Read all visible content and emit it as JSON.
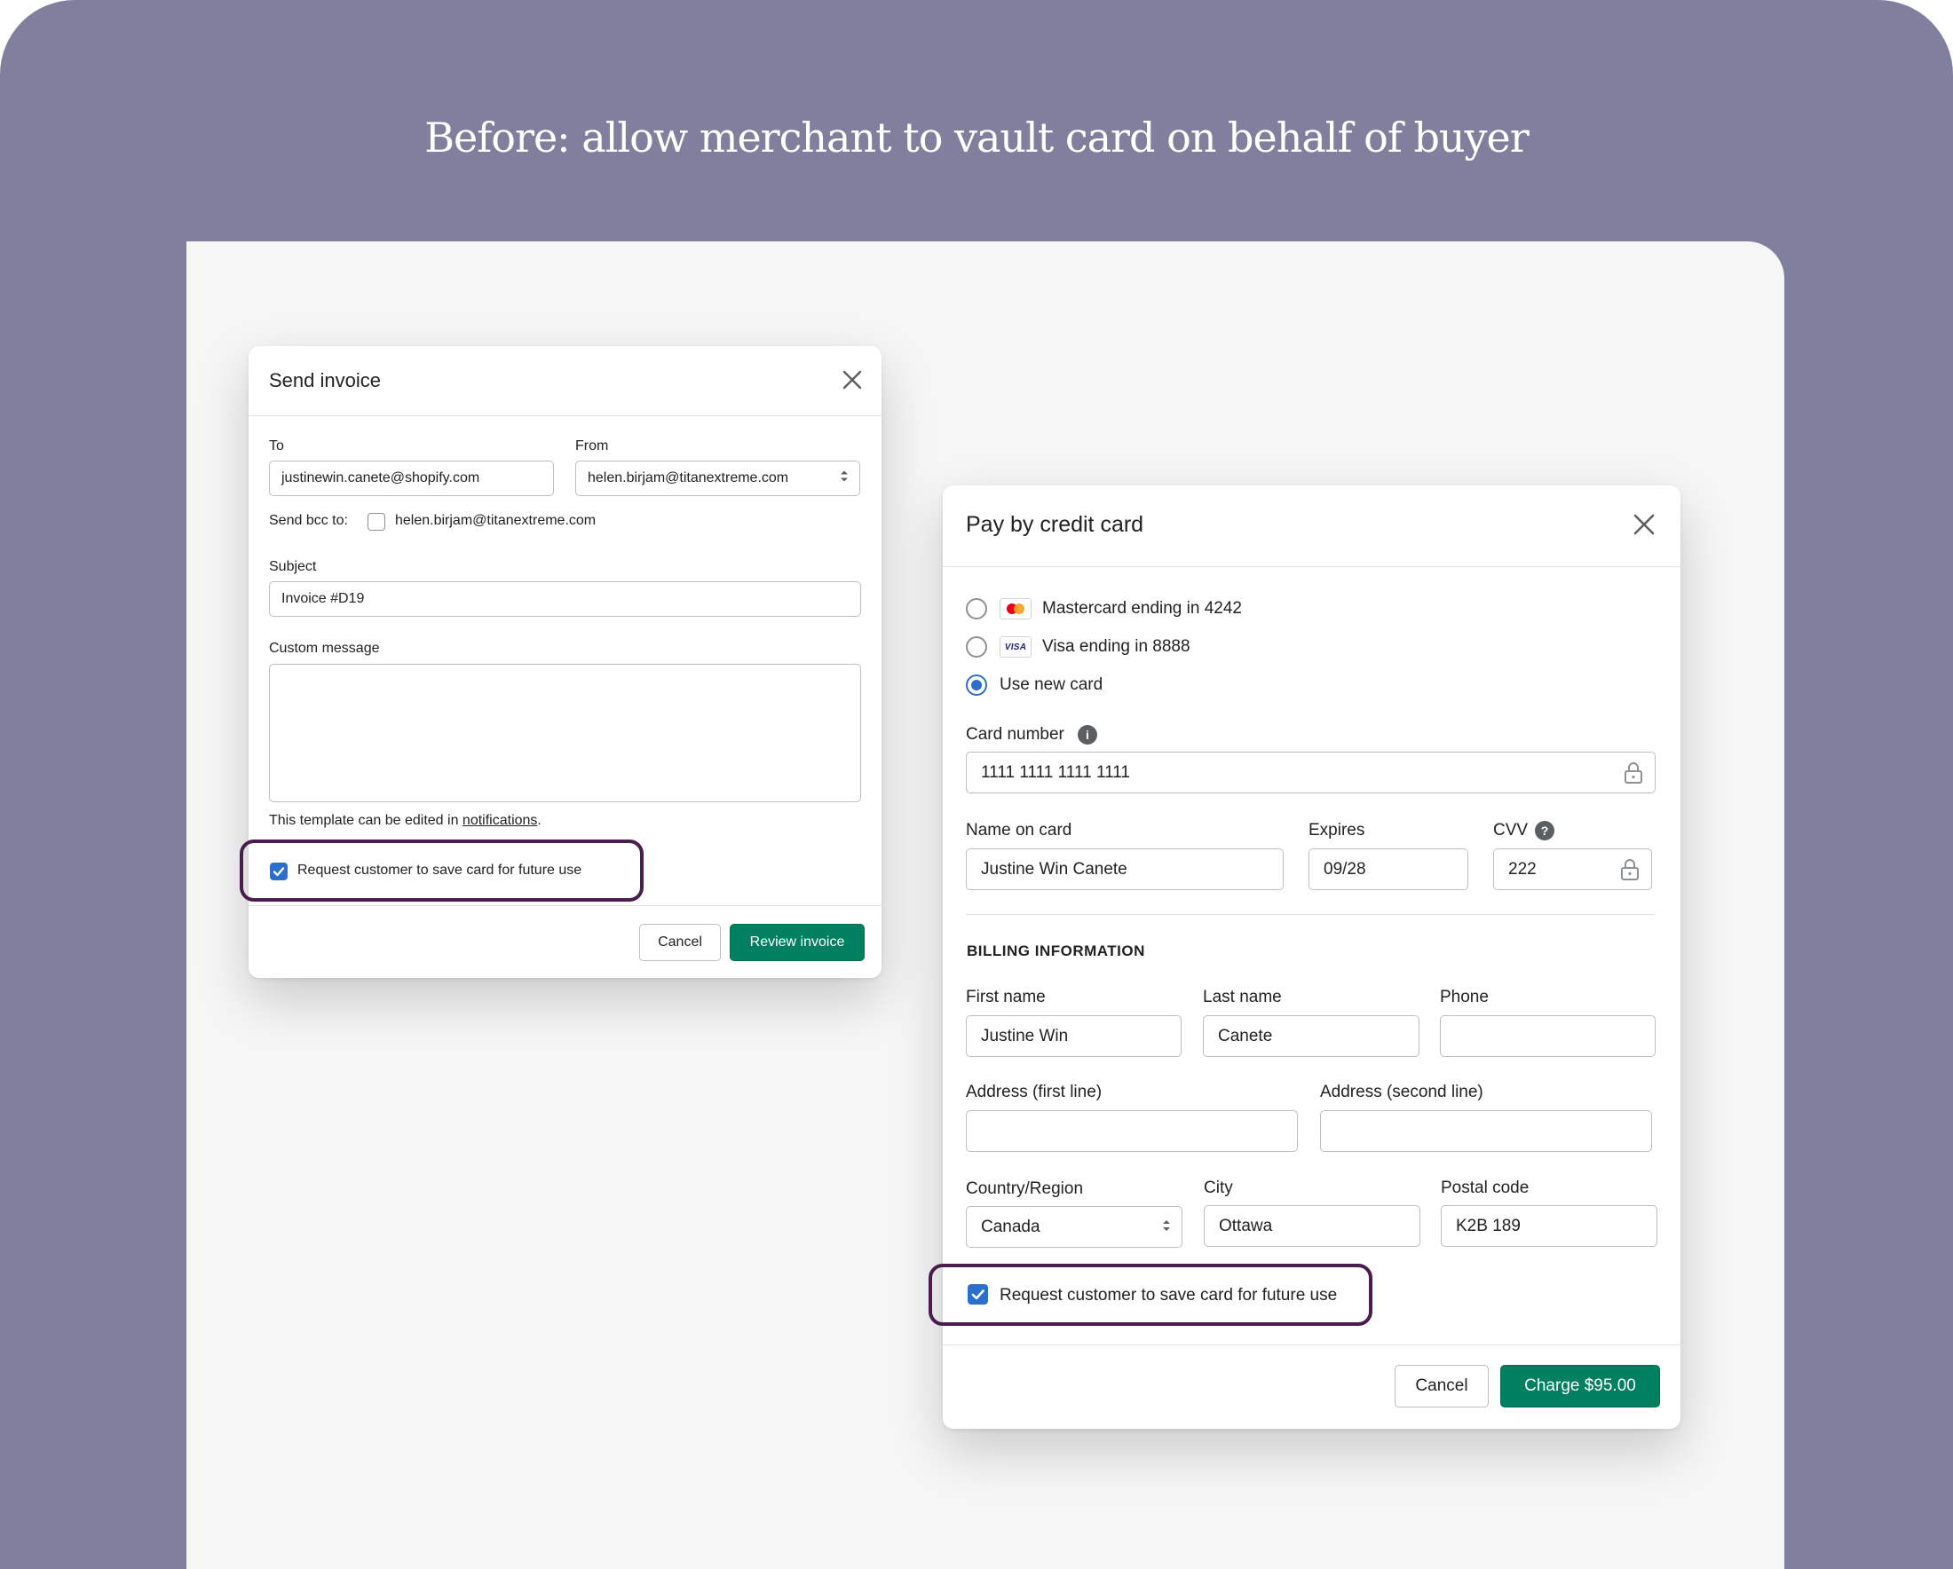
{
  "headline": "Before: allow merchant to vault card on behalf of buyer",
  "colors": {
    "background": "#80809e",
    "canvas": "#f6f6f7",
    "primary_button": "#008060",
    "checkbox_checked": "#2c6ecb",
    "highlight_outline": "#4a1d4f"
  },
  "send_invoice": {
    "title": "Send invoice",
    "close_icon": "close-icon",
    "to_label": "To",
    "to_value": "justinewin.canete@shopify.com",
    "from_label": "From",
    "from_value": "helen.birjam@titanextreme.com",
    "bcc_label": "Send bcc to:",
    "bcc_value": "helen.birjam@titanextreme.com",
    "bcc_checked": false,
    "subject_label": "Subject",
    "subject_value": "Invoice #D19",
    "message_label": "Custom message",
    "message_value": "",
    "template_note_prefix": "This template can be edited in",
    "template_note_link": "notifications",
    "template_note_suffix": ".",
    "save_card_label": "Request customer to save card for future use",
    "save_card_checked": true,
    "cancel_label": "Cancel",
    "review_label": "Review invoice"
  },
  "pay_card": {
    "title": "Pay by credit card",
    "close_icon": "close-icon",
    "options": [
      {
        "label": "Mastercard ending in 4242",
        "icon": "mastercard-icon",
        "selected": false
      },
      {
        "label": "Visa ending in 8888",
        "icon": "visa-icon",
        "visa_text": "VISA",
        "selected": false
      },
      {
        "label": "Use new card",
        "selected": true
      }
    ],
    "card_number_label": "Card number",
    "card_number_value": "1111 1111 1111 1111",
    "name_label": "Name on card",
    "name_value": "Justine Win Canete",
    "expires_label": "Expires",
    "expires_value": "09/28",
    "cvv_label": "CVV",
    "cvv_value": "222",
    "info_glyph": "i",
    "help_glyph": "?",
    "billing_title": "BILLING INFORMATION",
    "first_name_label": "First name",
    "first_name_value": "Justine Win",
    "last_name_label": "Last name",
    "last_name_value": "Canete",
    "phone_label": "Phone",
    "phone_value": "",
    "address1_label": "Address (first line)",
    "address1_value": "",
    "address2_label": "Address (second line)",
    "address2_value": "",
    "country_label": "Country/Region",
    "country_value": "Canada",
    "city_label": "City",
    "city_value": "Ottawa",
    "postal_label": "Postal code",
    "postal_value": "K2B 189",
    "save_card_label": "Request customer to save card for future use",
    "save_card_checked": true,
    "cancel_label": "Cancel",
    "charge_label": "Charge $95.00"
  }
}
